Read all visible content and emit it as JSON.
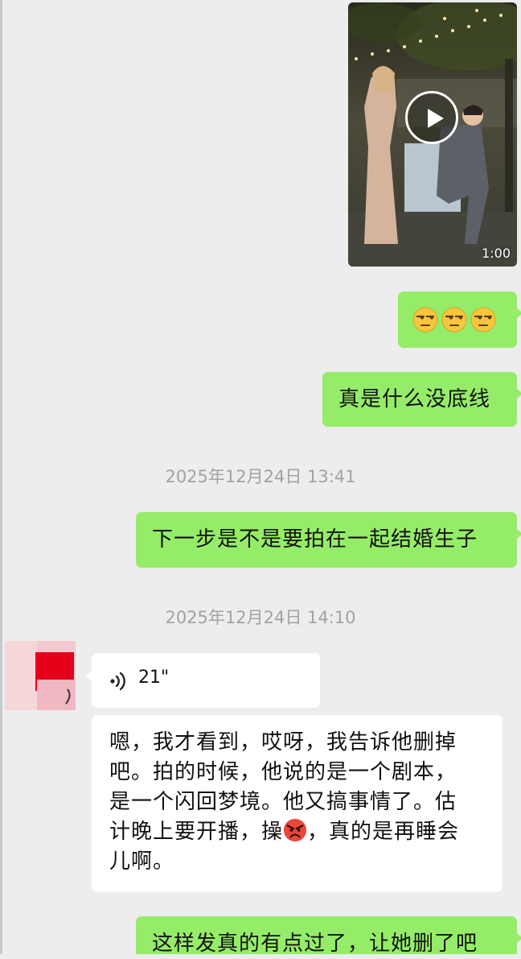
{
  "messages": {
    "video": {
      "duration": "1:00"
    },
    "emoji_msg": {
      "emojis": [
        "unamused-face",
        "unamused-face",
        "unamused-face"
      ]
    },
    "msg1": {
      "text": "真是什么没底线"
    },
    "timestamp1": "2025年12月24日 13:41",
    "msg2": {
      "text": "下一步是不是要拍在一起结婚生子"
    },
    "timestamp2": "2025年12月24日 14:10",
    "voice": {
      "length": "21\""
    },
    "msg3": {
      "lines": [
        "嗯，我才看到，哎呀，我告诉他删掉",
        "吧。拍的时候，他说的是一个剧本，",
        "是一个闪回梦境。他又搞事情了。估",
        "计晚上要开播，操",
        "，真的是再睡会",
        "儿啊。"
      ],
      "inline_emoji": "angry-face"
    },
    "msg4": {
      "text": "这样发真的有点过了，让她删了吧"
    }
  },
  "colors": {
    "background": "#ededed",
    "sent_bubble": "#95ec69",
    "received_bubble": "#ffffff",
    "timestamp_text": "#a2a2a2"
  }
}
